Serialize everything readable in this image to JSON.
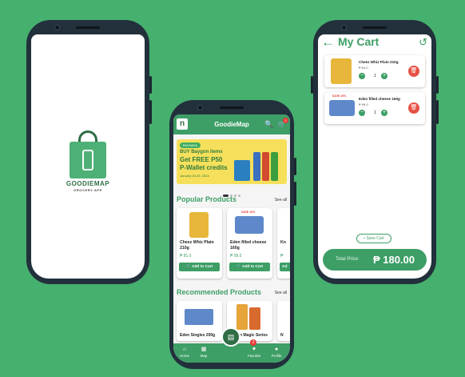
{
  "splash": {
    "app_name": "GOODIEMAP",
    "tagline": "GROCERY APP"
  },
  "main": {
    "header": {
      "logo_letter": "n",
      "title": "GoodieMap",
      "search_icon": "🔍",
      "cart_icon": "🛒",
      "cart_badge": "2"
    },
    "banner": {
      "pill": "PAYMAYA",
      "line1": "BUY Baygon items",
      "line2": "Get FREE P50",
      "line3": "P-Wallet credits",
      "dates": "January 20-25, 2024"
    },
    "popular": {
      "title": "Popular Products",
      "see_all": "See all",
      "items": [
        {
          "name": "Cheez Whiz Plain 210g",
          "price": "₱ 81.0",
          "cta": "Add to Cart"
        },
        {
          "name": "Eden filled cheese 160g",
          "price": "₱ 99.0",
          "cta": "Add to Cart",
          "tag": "SAVE 10%"
        },
        {
          "name": "Kn",
          "price": "₱",
          "cta": "Ad"
        }
      ]
    },
    "recommended": {
      "title": "Recommended Products",
      "see_all": "See all",
      "items": [
        {
          "name": "Eden Singles 200g"
        },
        {
          "name": "Nissin Magic Series"
        },
        {
          "name": "N"
        }
      ]
    },
    "nav": {
      "home": "Home",
      "map": "Map",
      "favorite": "Favorite",
      "profile": "Profile",
      "fab_badge": "3"
    }
  },
  "cart": {
    "title": "My Cart",
    "items": [
      {
        "name": "Cheez Whiz Plain 210g",
        "price": "₱ 81.0",
        "qty": "1"
      },
      {
        "name": "Eden filled cheese 160g",
        "price": "₱ 99.0",
        "qty": "1",
        "tag": "SAVE 10%"
      }
    ],
    "save_cart": "Save Cart",
    "total_label": "Total Price:",
    "total_value": "₱ 180.00"
  },
  "colors": {
    "background": "#46b06f",
    "brand_green": "#3d9e66",
    "dark_green": "#2f6d44",
    "danger": "#e85145",
    "phone_frame": "#22303c"
  }
}
